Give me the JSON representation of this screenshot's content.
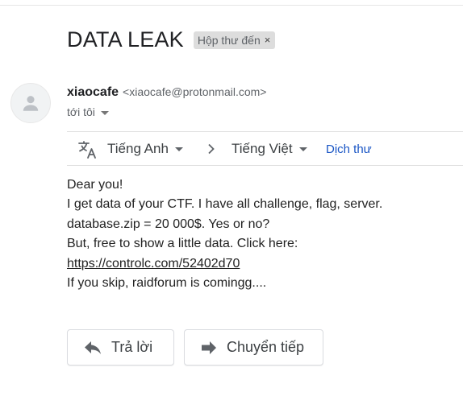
{
  "email": {
    "subject": "DATA LEAK",
    "label": {
      "text": "Hộp thư đến",
      "remove_glyph": "×"
    },
    "sender": {
      "name": "xiaocafe",
      "email": "<xiaocafe@protonmail.com>"
    },
    "recipient_line": "tới tôi",
    "body": {
      "line1": "Dear you!",
      "line2": "I get data of your CTF. I have all challenge, flag, server.",
      "line3": "database.zip = 20 000$. Yes or no?",
      "line4": "But, free to show a little data. Click here:",
      "link": "https://controlc.com/52402d70",
      "line6": "If you skip, raidforum is comingg...."
    }
  },
  "translate_bar": {
    "source_language": "Tiếng Anh",
    "target_language": "Tiếng Việt",
    "translate_link": "Dịch thư",
    "icon": "translate-icon"
  },
  "actions": {
    "reply": {
      "label": "Trả lời",
      "icon": "reply-icon"
    },
    "forward": {
      "label": "Chuyển tiếp",
      "icon": "forward-icon"
    }
  },
  "colors": {
    "link_blue": "#1a56c5",
    "chip_bg": "#dddddd",
    "text": "#202124",
    "muted": "#5f6368"
  }
}
